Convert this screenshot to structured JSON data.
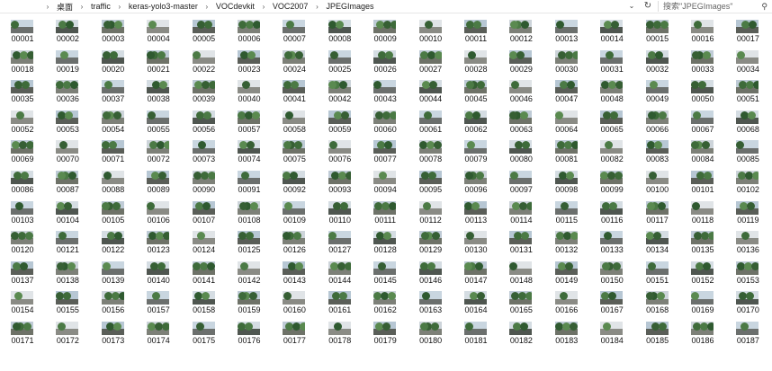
{
  "address": {
    "crumbs": [
      "桌面",
      "traffic",
      "keras-yolo3-master",
      "VOCdevkit",
      "VOC2007",
      "JPEGImages"
    ],
    "dropdown_icon": "chevron-down-icon",
    "refresh_icon": "refresh-icon",
    "search_placeholder": "搜索\"JPEGImages\"",
    "search_icon": "search-icon"
  },
  "files": {
    "items": [
      "00001",
      "00002",
      "00003",
      "00004",
      "00005",
      "00006",
      "00007",
      "00008",
      "00009",
      "00010",
      "00011",
      "00012",
      "00013",
      "00014",
      "00015",
      "00016",
      "00017",
      "00018",
      "00019",
      "00020",
      "00021",
      "00022",
      "00023",
      "00024",
      "00025",
      "00026",
      "00027",
      "00028",
      "00029",
      "00030",
      "00031",
      "00032",
      "00033",
      "00034",
      "00035",
      "00036",
      "00037",
      "00038",
      "00039",
      "00040",
      "00041",
      "00042",
      "00043",
      "00044",
      "00045",
      "00046",
      "00047",
      "00048",
      "00049",
      "00050",
      "00051",
      "00052",
      "00053",
      "00054",
      "00055",
      "00056",
      "00057",
      "00058",
      "00059",
      "00060",
      "00061",
      "00062",
      "00063",
      "00064",
      "00065",
      "00066",
      "00067",
      "00068",
      "00069",
      "00070",
      "00071",
      "00072",
      "00073",
      "00074",
      "00075",
      "00076",
      "00077",
      "00078",
      "00079",
      "00080",
      "00081",
      "00082",
      "00083",
      "00084",
      "00085",
      "00086",
      "00087",
      "00088",
      "00089",
      "00090",
      "00091",
      "00092",
      "00093",
      "00094",
      "00095",
      "00096",
      "00097",
      "00098",
      "00099",
      "00100",
      "00101",
      "00102",
      "00103",
      "00104",
      "00105",
      "00106",
      "00107",
      "00108",
      "00109",
      "00110",
      "00111",
      "00112",
      "00113",
      "00114",
      "00115",
      "00116",
      "00117",
      "00118",
      "00119",
      "00120",
      "00121",
      "00122",
      "00123",
      "00124",
      "00125",
      "00126",
      "00127",
      "00128",
      "00129",
      "00130",
      "00131",
      "00132",
      "00133",
      "00134",
      "00135",
      "00136",
      "00137",
      "00138",
      "00139",
      "00140",
      "00141",
      "00142",
      "00143",
      "00144",
      "00145",
      "00146",
      "00147",
      "00148",
      "00149",
      "00150",
      "00151",
      "00152",
      "00153",
      "00154",
      "00155",
      "00156",
      "00157",
      "00158",
      "00159",
      "00160",
      "00161",
      "00162",
      "00163",
      "00164",
      "00165",
      "00166",
      "00167",
      "00168",
      "00169",
      "00170",
      "00171",
      "00172",
      "00173",
      "00174",
      "00175",
      "00176",
      "00177",
      "00178",
      "00179",
      "00180",
      "00181",
      "00182",
      "00183",
      "00184",
      "00185",
      "00186",
      "00187"
    ]
  }
}
